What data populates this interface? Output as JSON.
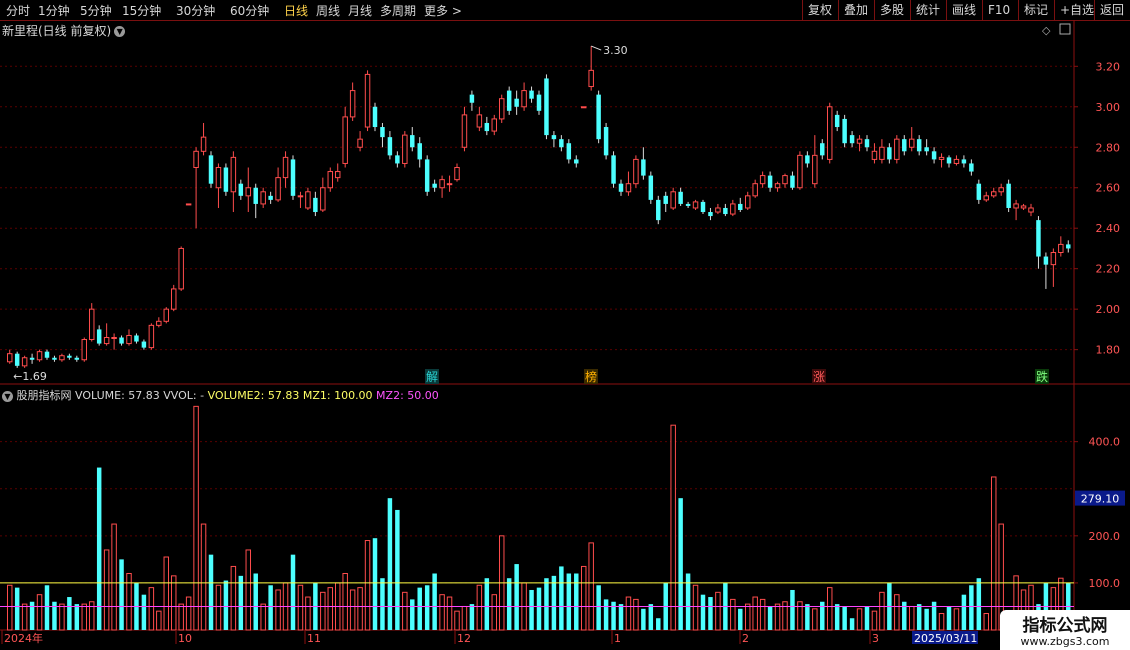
{
  "toolbar": {
    "periods": [
      "分时",
      "1分钟",
      "5分钟",
      "15分钟",
      "30分钟",
      "60分钟",
      "日线",
      "周线",
      "月线",
      "多周期",
      "更多 >"
    ],
    "active": "日线",
    "right": [
      "复权",
      "叠加",
      "多股",
      "统计",
      "画线",
      "F10",
      "标记",
      "+自选",
      "返回"
    ]
  },
  "price_panel": {
    "title": "新里程(日线 前复权)",
    "high_label": "3.30",
    "low_label": "1.69",
    "y_ticks": [
      "3.20",
      "3.00",
      "2.80",
      "2.60",
      "2.40",
      "2.20",
      "2.00",
      "1.80"
    ],
    "events": [
      {
        "label": "解",
        "color": "#29d3d3",
        "bg": "#0a3a3a"
      },
      {
        "label": "榜",
        "color": "#ffb000",
        "bg": "#3a2a00"
      },
      {
        "label": "涨",
        "color": "#ff5a5a",
        "bg": "#3a0a0a"
      },
      {
        "label": "跌",
        "color": "#7fff7f",
        "bg": "#0a3a0a"
      }
    ]
  },
  "volume_panel": {
    "indicator_name": "股朋指标网",
    "labels": [
      {
        "text": "VOLUME: 57.83",
        "color": "#d8d8d8"
      },
      {
        "text": "VVOL: -",
        "color": "#d8d8d8"
      },
      {
        "text": "VOLUME2: 57.83",
        "color": "#ffff66"
      },
      {
        "text": "MZ1: 100.00",
        "color": "#ffff66"
      },
      {
        "text": "MZ2: 50.00",
        "color": "#ff55ff"
      }
    ],
    "y_ticks": [
      "400.0",
      "200.0",
      "100.0"
    ],
    "current_value": "279.10"
  },
  "x_axis": {
    "labels": [
      "2024年",
      "10",
      "11",
      "12",
      "1",
      "2",
      "3"
    ],
    "highlight": "2025/03/11"
  },
  "watermark": {
    "title": "指标公式网",
    "url": "www.zbgs3.com"
  },
  "colors": {
    "up": "#ff4d4d",
    "down": "#4dffff",
    "grid": "#5a0000",
    "axis": "#8b1010",
    "mz1": "#ffff44",
    "mz2": "#ff44ff"
  },
  "chart_data": {
    "type": "candlestick",
    "price_range": [
      1.65,
      3.33
    ],
    "volume_range": [
      0,
      480
    ],
    "mz1": 100,
    "mz2": 50,
    "candles": [
      [
        1.74,
        1.78,
        1.8,
        1.73
      ],
      [
        1.78,
        1.72,
        1.79,
        1.71
      ],
      [
        1.72,
        1.76,
        1.77,
        1.71
      ],
      [
        1.76,
        1.75,
        1.78,
        1.73
      ],
      [
        1.75,
        1.79,
        1.8,
        1.74
      ],
      [
        1.79,
        1.76,
        1.8,
        1.75
      ],
      [
        1.76,
        1.75,
        1.77,
        1.74
      ],
      [
        1.75,
        1.77,
        1.78,
        1.74
      ],
      [
        1.77,
        1.76,
        1.78,
        1.75
      ],
      [
        1.76,
        1.75,
        1.77,
        1.74
      ],
      [
        1.75,
        1.85,
        1.86,
        1.74
      ],
      [
        1.85,
        2.0,
        2.03,
        1.84
      ],
      [
        1.9,
        1.83,
        1.92,
        1.82
      ],
      [
        1.83,
        1.86,
        1.93,
        1.82
      ],
      [
        1.86,
        1.86,
        1.88,
        1.8
      ],
      [
        1.86,
        1.83,
        1.87,
        1.82
      ],
      [
        1.83,
        1.87,
        1.9,
        1.82
      ],
      [
        1.87,
        1.84,
        1.88,
        1.83
      ],
      [
        1.84,
        1.81,
        1.85,
        1.8
      ],
      [
        1.81,
        1.92,
        1.93,
        1.8
      ],
      [
        1.92,
        1.94,
        1.96,
        1.91
      ],
      [
        1.94,
        2.0,
        2.01,
        1.93
      ],
      [
        2.0,
        2.1,
        2.12,
        1.99
      ],
      [
        2.1,
        2.3,
        2.31,
        2.09
      ],
      [
        2.52,
        2.52,
        2.52,
        2.52
      ],
      [
        2.7,
        2.78,
        2.8,
        2.4
      ],
      [
        2.78,
        2.85,
        2.92,
        2.76
      ],
      [
        2.76,
        2.62,
        2.78,
        2.6
      ],
      [
        2.6,
        2.7,
        2.72,
        2.5
      ],
      [
        2.7,
        2.58,
        2.72,
        2.56
      ],
      [
        2.58,
        2.75,
        2.78,
        2.48
      ],
      [
        2.62,
        2.56,
        2.64,
        2.54
      ],
      [
        2.56,
        2.6,
        2.7,
        2.48
      ],
      [
        2.6,
        2.52,
        2.62,
        2.45
      ],
      [
        2.52,
        2.58,
        2.6,
        2.5
      ],
      [
        2.56,
        2.54,
        2.58,
        2.52
      ],
      [
        2.54,
        2.65,
        2.7,
        2.53
      ],
      [
        2.65,
        2.75,
        2.78,
        2.6
      ],
      [
        2.74,
        2.56,
        2.76,
        2.54
      ],
      [
        2.56,
        2.56,
        2.58,
        2.5
      ],
      [
        2.5,
        2.58,
        2.6,
        2.49
      ],
      [
        2.55,
        2.48,
        2.58,
        2.46
      ],
      [
        2.49,
        2.6,
        2.65,
        2.48
      ],
      [
        2.6,
        2.68,
        2.7,
        2.58
      ],
      [
        2.65,
        2.68,
        2.72,
        2.63
      ],
      [
        2.72,
        2.95,
        3.0,
        2.7
      ],
      [
        2.95,
        3.08,
        3.12,
        2.93
      ],
      [
        2.8,
        2.84,
        2.88,
        2.78
      ],
      [
        2.9,
        3.16,
        3.18,
        2.88
      ],
      [
        3.0,
        2.9,
        3.02,
        2.88
      ],
      [
        2.9,
        2.85,
        2.92,
        2.8
      ],
      [
        2.85,
        2.76,
        2.88,
        2.74
      ],
      [
        2.76,
        2.72,
        2.78,
        2.7
      ],
      [
        2.72,
        2.86,
        2.88,
        2.7
      ],
      [
        2.86,
        2.8,
        2.9,
        2.78
      ],
      [
        2.82,
        2.74,
        2.85,
        2.7
      ],
      [
        2.74,
        2.58,
        2.76,
        2.56
      ],
      [
        2.62,
        2.6,
        2.64,
        2.58
      ],
      [
        2.6,
        2.64,
        2.66,
        2.55
      ],
      [
        2.62,
        2.62,
        2.66,
        2.58
      ],
      [
        2.64,
        2.7,
        2.72,
        2.63
      ],
      [
        2.8,
        2.96,
        3.0,
        2.78
      ],
      [
        3.06,
        3.02,
        3.08,
        2.98
      ],
      [
        2.9,
        2.96,
        3.0,
        2.88
      ],
      [
        2.92,
        2.88,
        2.95,
        2.86
      ],
      [
        2.88,
        2.94,
        2.96,
        2.86
      ],
      [
        2.94,
        3.04,
        3.06,
        2.92
      ],
      [
        3.08,
        2.98,
        3.1,
        2.96
      ],
      [
        3.04,
        3.0,
        3.08,
        2.96
      ],
      [
        3.0,
        3.08,
        3.12,
        2.98
      ],
      [
        3.08,
        3.04,
        3.1,
        3.02
      ],
      [
        3.06,
        2.98,
        3.08,
        2.96
      ],
      [
        3.14,
        2.86,
        3.16,
        2.84
      ],
      [
        2.86,
        2.84,
        2.88,
        2.8
      ],
      [
        2.84,
        2.8,
        2.86,
        2.78
      ],
      [
        2.82,
        2.74,
        2.84,
        2.72
      ],
      [
        2.74,
        2.72,
        2.76,
        2.7
      ],
      [
        3.0,
        3.0,
        3.0,
        3.0
      ],
      [
        3.1,
        3.18,
        3.3,
        3.08
      ],
      [
        3.06,
        2.84,
        3.08,
        2.82
      ],
      [
        2.9,
        2.76,
        2.92,
        2.74
      ],
      [
        2.76,
        2.62,
        2.78,
        2.6
      ],
      [
        2.62,
        2.58,
        2.64,
        2.56
      ],
      [
        2.58,
        2.62,
        2.68,
        2.56
      ],
      [
        2.62,
        2.74,
        2.76,
        2.6
      ],
      [
        2.74,
        2.66,
        2.8,
        2.64
      ],
      [
        2.66,
        2.54,
        2.68,
        2.52
      ],
      [
        2.54,
        2.44,
        2.56,
        2.42
      ],
      [
        2.56,
        2.52,
        2.58,
        2.48
      ],
      [
        2.5,
        2.58,
        2.6,
        2.49
      ],
      [
        2.58,
        2.52,
        2.6,
        2.51
      ],
      [
        2.52,
        2.51,
        2.53,
        2.5
      ],
      [
        2.5,
        2.53,
        2.54,
        2.49
      ],
      [
        2.53,
        2.48,
        2.54,
        2.47
      ],
      [
        2.48,
        2.46,
        2.5,
        2.44
      ],
      [
        2.48,
        2.5,
        2.52,
        2.47
      ],
      [
        2.5,
        2.47,
        2.52,
        2.46
      ],
      [
        2.47,
        2.52,
        2.54,
        2.46
      ],
      [
        2.52,
        2.49,
        2.55,
        2.48
      ],
      [
        2.5,
        2.56,
        2.58,
        2.49
      ],
      [
        2.56,
        2.62,
        2.64,
        2.55
      ],
      [
        2.62,
        2.66,
        2.68,
        2.6
      ],
      [
        2.66,
        2.6,
        2.68,
        2.58
      ],
      [
        2.6,
        2.62,
        2.63,
        2.58
      ],
      [
        2.62,
        2.66,
        2.67,
        2.6
      ],
      [
        2.66,
        2.6,
        2.68,
        2.59
      ],
      [
        2.6,
        2.76,
        2.78,
        2.59
      ],
      [
        2.76,
        2.72,
        2.78,
        2.7
      ],
      [
        2.62,
        2.76,
        2.86,
        2.6
      ],
      [
        2.82,
        2.76,
        2.84,
        2.74
      ],
      [
        2.74,
        3.0,
        3.02,
        2.72
      ],
      [
        2.96,
        2.9,
        2.98,
        2.88
      ],
      [
        2.94,
        2.82,
        2.96,
        2.8
      ],
      [
        2.86,
        2.82,
        2.88,
        2.8
      ],
      [
        2.82,
        2.84,
        2.86,
        2.78
      ],
      [
        2.84,
        2.8,
        2.86,
        2.78
      ],
      [
        2.74,
        2.78,
        2.82,
        2.72
      ],
      [
        2.74,
        2.8,
        2.84,
        2.72
      ],
      [
        2.8,
        2.74,
        2.82,
        2.72
      ],
      [
        2.74,
        2.84,
        2.86,
        2.72
      ],
      [
        2.84,
        2.78,
        2.86,
        2.76
      ],
      [
        2.8,
        2.84,
        2.9,
        2.78
      ],
      [
        2.84,
        2.78,
        2.86,
        2.76
      ],
      [
        2.8,
        2.78,
        2.84,
        2.76
      ],
      [
        2.78,
        2.74,
        2.8,
        2.72
      ],
      [
        2.74,
        2.75,
        2.77,
        2.7
      ],
      [
        2.75,
        2.72,
        2.76,
        2.7
      ],
      [
        2.72,
        2.74,
        2.76,
        2.71
      ],
      [
        2.74,
        2.72,
        2.76,
        2.7
      ],
      [
        2.72,
        2.68,
        2.74,
        2.66
      ],
      [
        2.62,
        2.54,
        2.64,
        2.52
      ],
      [
        2.54,
        2.56,
        2.58,
        2.53
      ],
      [
        2.56,
        2.58,
        2.6,
        2.55
      ],
      [
        2.58,
        2.6,
        2.62,
        2.56
      ],
      [
        2.62,
        2.5,
        2.64,
        2.48
      ],
      [
        2.5,
        2.52,
        2.54,
        2.44
      ],
      [
        2.5,
        2.51,
        2.52,
        2.49
      ],
      [
        2.48,
        2.5,
        2.52,
        2.46
      ],
      [
        2.44,
        2.26,
        2.46,
        2.2
      ],
      [
        2.26,
        2.22,
        2.28,
        2.1
      ],
      [
        2.22,
        2.28,
        2.3,
        2.11
      ],
      [
        2.28,
        2.32,
        2.36,
        2.26
      ],
      [
        2.32,
        2.3,
        2.34,
        2.28
      ]
    ],
    "volumes": [
      95,
      90,
      55,
      60,
      75,
      95,
      60,
      55,
      70,
      55,
      55,
      60,
      345,
      170,
      225,
      150,
      120,
      100,
      75,
      90,
      40,
      155,
      115,
      55,
      70,
      475,
      225,
      160,
      95,
      105,
      135,
      115,
      170,
      120,
      55,
      95,
      85,
      100,
      160,
      95,
      70,
      100,
      80,
      90,
      100,
      120,
      85,
      90,
      190,
      195,
      110,
      280,
      255,
      80,
      65,
      90,
      95,
      120,
      75,
      70,
      40,
      50,
      55,
      95,
      110,
      75,
      200,
      110,
      140,
      100,
      85,
      90,
      110,
      115,
      135,
      120,
      120,
      135,
      185,
      95,
      65,
      60,
      55,
      70,
      65,
      45,
      55,
      25,
      100,
      435,
      280,
      120,
      95,
      75,
      70,
      80,
      100,
      65,
      45,
      55,
      70,
      65,
      50,
      55,
      60,
      85,
      60,
      55,
      45,
      60,
      90,
      55,
      50,
      25,
      45,
      50,
      40,
      80,
      100,
      75,
      60,
      50,
      55,
      45,
      60,
      35,
      50,
      45,
      75,
      95,
      110,
      35,
      325,
      225,
      40,
      115,
      85,
      95,
      55,
      100,
      90,
      110,
      100,
      90,
      60,
      75,
      95,
      80,
      100,
      120,
      60,
      40,
      85,
      60,
      55,
      95,
      90,
      100,
      80,
      75
    ]
  }
}
